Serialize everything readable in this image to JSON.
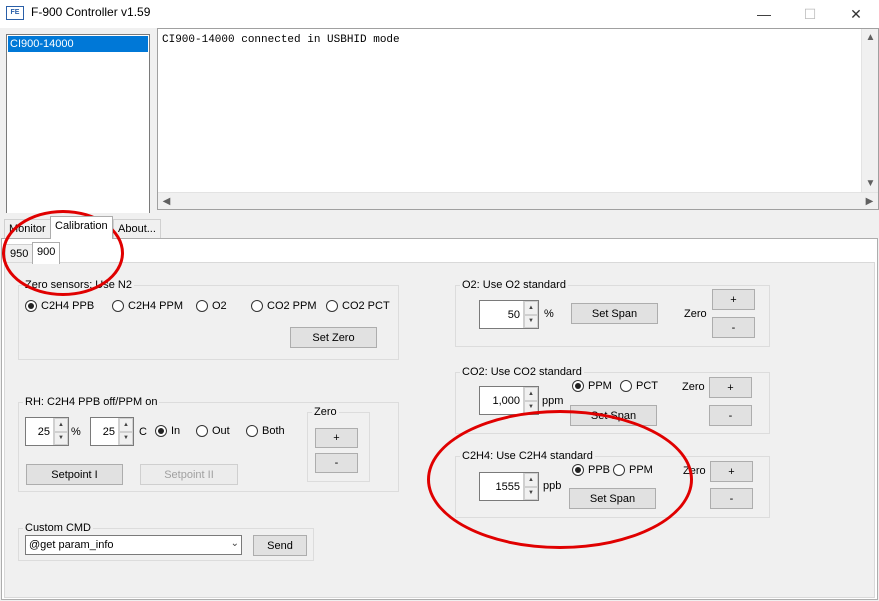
{
  "window": {
    "title": "F-900 Controller v1.59",
    "icon": "app-logo-icon",
    "controls": {
      "minimize": "—",
      "maximize": "☐",
      "close": "✕"
    }
  },
  "devices": [
    "CI900-14000"
  ],
  "log": {
    "text": "CI900-14000 connected in USBHID mode"
  },
  "tabs": [
    "Monitor",
    "Calibration",
    "About..."
  ],
  "subtabs": [
    "950",
    "900"
  ],
  "zero_sensors": {
    "title": "Zero sensors: Use N2",
    "options": [
      "C2H4 PPB",
      "C2H4 PPM",
      "O2",
      "CO2 PPM",
      "CO2 PCT"
    ],
    "selected": "C2H4 PPB",
    "button": "Set Zero"
  },
  "rh": {
    "title": "RH: C2H4 PPB off/PPM on",
    "humidity_value": "25",
    "humidity_unit": "%",
    "temp_value": "25",
    "temp_unit": "C",
    "options": [
      "In",
      "Out",
      "Both"
    ],
    "selected": "In",
    "setpoint1": "Setpoint I",
    "setpoint2": "Setpoint II",
    "zero_title": "Zero",
    "plus": "+",
    "minus": "-"
  },
  "custom_cmd": {
    "title": "Custom CMD",
    "value": "@get param_info",
    "send": "Send"
  },
  "o2": {
    "title": "O2: Use O2 standard",
    "value": "50",
    "unit": "%",
    "set_span": "Set Span",
    "zero_label": "Zero",
    "plus": "+",
    "minus": "-"
  },
  "co2": {
    "title": "CO2: Use CO2 standard",
    "value": "1,000",
    "unit": "ppm",
    "options": [
      "PPM",
      "PCT"
    ],
    "selected": "PPM",
    "set_span": "Set Span",
    "zero_label": "Zero",
    "plus": "+",
    "minus": "-"
  },
  "c2h4": {
    "title": "C2H4: Use C2H4 standard",
    "value": "1555",
    "unit": "ppb",
    "options": [
      "PPB",
      "PPM"
    ],
    "selected": "PPB",
    "set_span": "Set Span",
    "zero_label": "Zero",
    "plus": "+",
    "minus": "-"
  },
  "colors": {
    "selection": "#0078d7",
    "annotation": "#e00000",
    "panel": "#f0f0f0"
  }
}
